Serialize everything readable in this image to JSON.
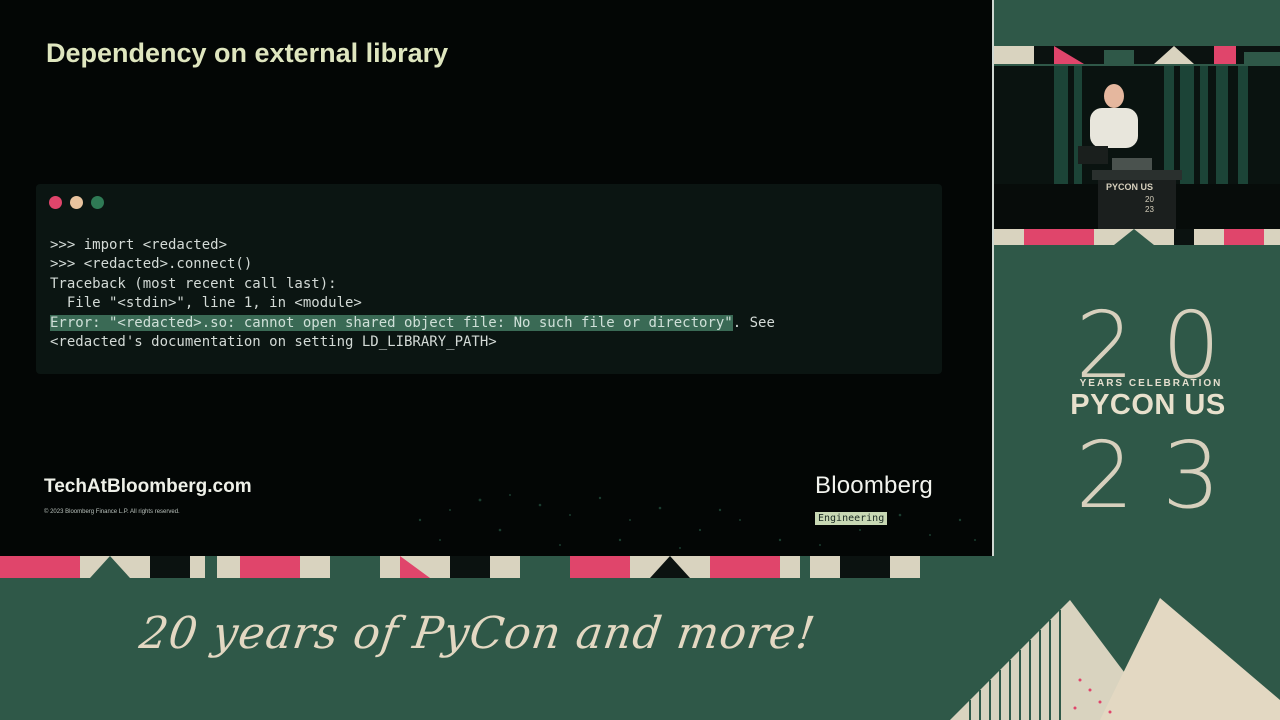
{
  "slide": {
    "title": "Dependency on external library",
    "terminal": {
      "dot_colors": [
        "#e0456b",
        "#e8c39e",
        "#2f7a55"
      ],
      "lines": [
        ">>> import <redacted>",
        ">>> <redacted>.connect()",
        "Traceback (most recent call last):",
        "  File \"<stdin>\", line 1, in <module>"
      ],
      "error_highlight": "Error: \"<redacted>.so: cannot open shared object file: No such file or directory\"",
      "error_tail": ". See",
      "last_line": "<redacted's documentation on setting LD_LIBRARY_PATH>"
    },
    "footer_url": "TechAtBloomberg.com",
    "copyright": "© 2023 Bloomberg Finance L.P. All rights reserved.",
    "brand": "Bloomberg",
    "brand_badge": "Engineering"
  },
  "camera": {
    "podium_label": "PYCON US",
    "podium_year_top": "20",
    "podium_year_bottom": "23"
  },
  "event_logo": {
    "year_top": "20",
    "tagline": "YEARS CELEBRATION",
    "name": "PYCON US",
    "year_bottom": "23"
  },
  "banner": {
    "tagline": "20 years of PyCon and more!"
  },
  "colors": {
    "background_green": "#2f5848",
    "accent_pink": "#e0456b",
    "cream": "#e3d8c2",
    "highlight": "#3a6a55"
  }
}
